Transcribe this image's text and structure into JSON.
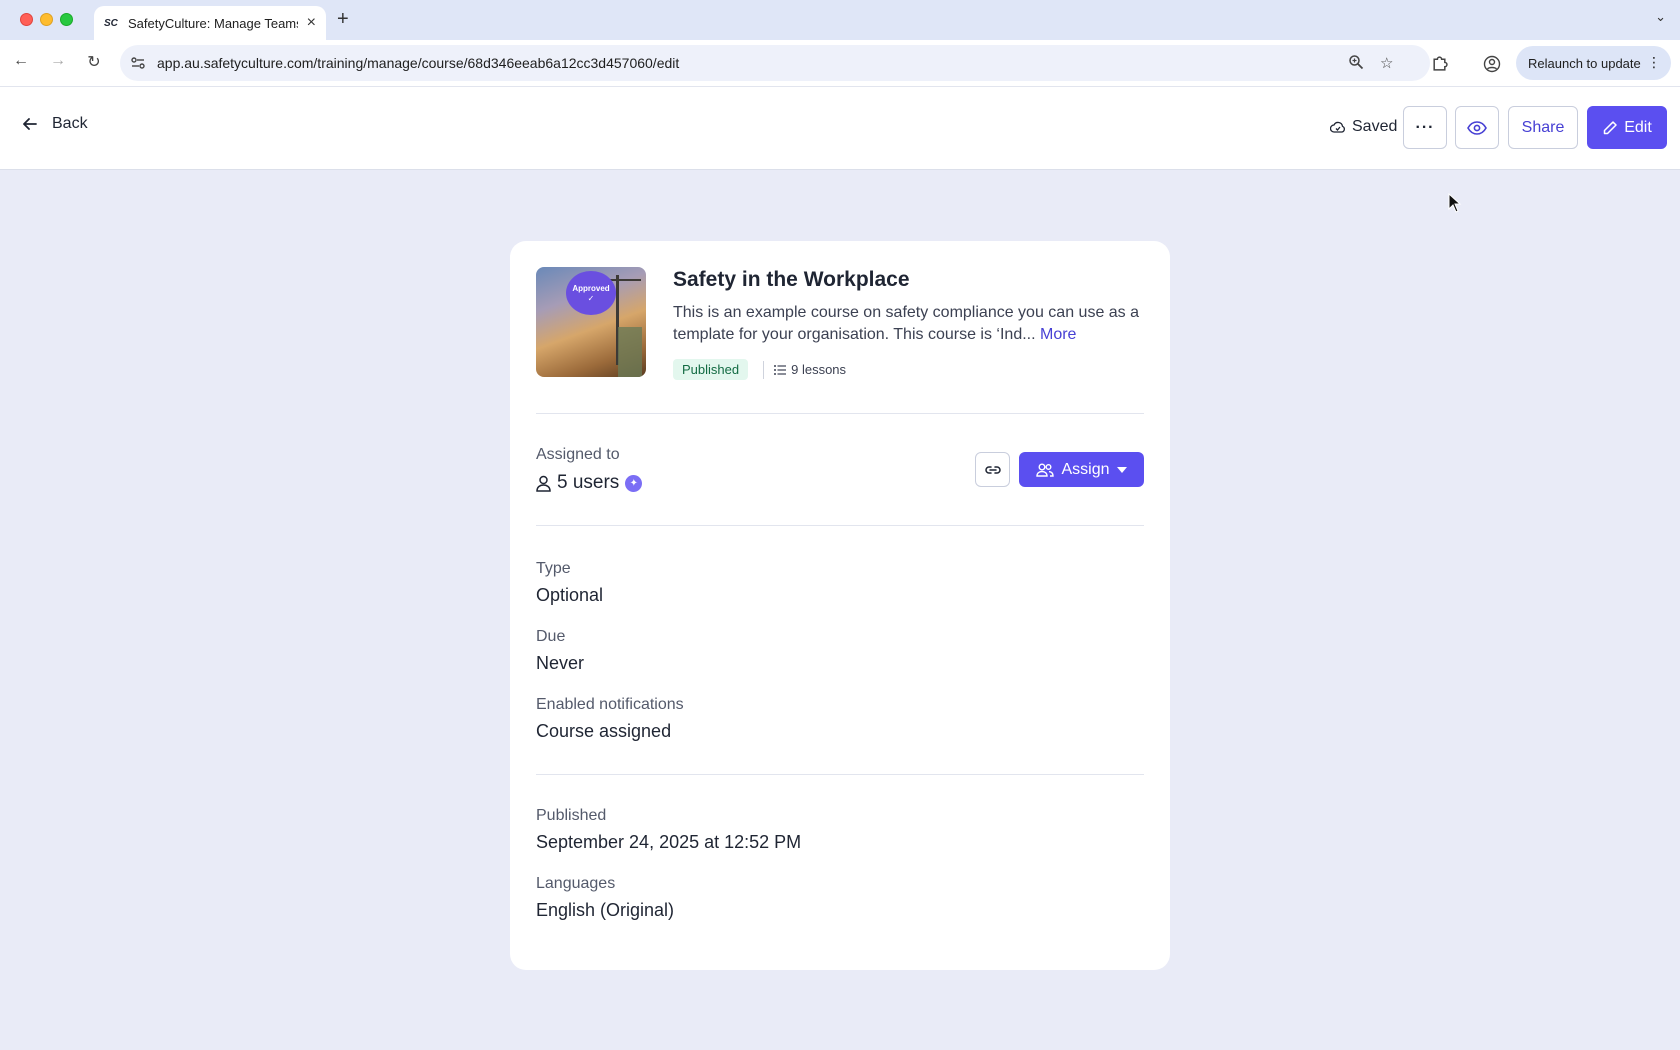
{
  "browser": {
    "tab_favicon": "SC",
    "tab_title": "SafetyCulture: Manage Teams",
    "new_tab": "+",
    "url": "app.au.safetyculture.com/training/manage/course/68d346eeab6a12cc3d457060/edit",
    "relaunch_label": "Relaunch to update"
  },
  "header": {
    "back_label": "Back",
    "saved_label": "Saved",
    "share_label": "Share",
    "edit_label": "Edit"
  },
  "course": {
    "thumbnail_badge": "Approved",
    "title": "Safety in the Workplace",
    "description": "This is an example course on safety compliance you can use as a template for your organisation. This course is ‘Ind...",
    "more_label": "More",
    "status": "Published",
    "lessons": "9 lessons"
  },
  "assignment": {
    "label": "Assigned to",
    "users": "5 users",
    "assign_label": "Assign"
  },
  "details": {
    "type_label": "Type",
    "type_value": "Optional",
    "due_label": "Due",
    "due_value": "Never",
    "notifications_label": "Enabled notifications",
    "notifications_value": "Course assigned",
    "published_label": "Published",
    "published_value": "September 24, 2025 at 12:52 PM",
    "languages_label": "Languages",
    "languages_value": "English (Original)"
  },
  "colors": {
    "primary": "#5b4ff0",
    "page_background": "#e9ebf7",
    "published_badge": "#e3f7ee"
  }
}
